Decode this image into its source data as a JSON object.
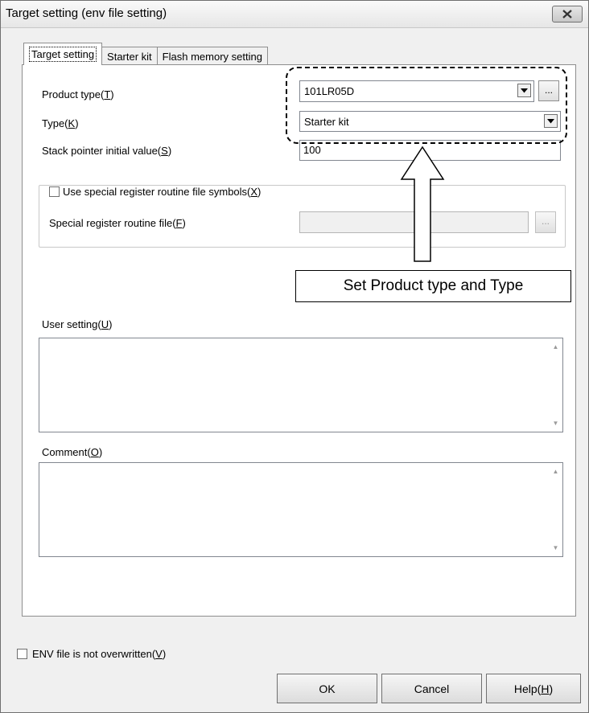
{
  "window": {
    "title": "Target setting (env file setting)"
  },
  "tabs": [
    {
      "label": "Target setting"
    },
    {
      "label": "Starter kit"
    },
    {
      "label": "Flash memory setting"
    }
  ],
  "form": {
    "product_type": {
      "label": "Product type(",
      "key": "T",
      "suffix": ")",
      "value": "101LR05D",
      "browse": "..."
    },
    "type": {
      "label": "Type(",
      "key": "K",
      "suffix": ")",
      "value": "Starter kit"
    },
    "stack_pointer": {
      "label": "Stack pointer initial value(",
      "key": "S",
      "suffix": ")",
      "value": "100"
    },
    "use_special": {
      "label": "Use special register routine file symbols(",
      "key": "X",
      "suffix": ")"
    },
    "special_file": {
      "label": "Special register routine file(",
      "key": "F",
      "suffix": ")",
      "value": "",
      "browse": "..."
    },
    "user_setting": {
      "label": "User setting(",
      "key": "U",
      "suffix": ")",
      "value": ""
    },
    "comment": {
      "label": "Comment(",
      "key": "O",
      "suffix": ")",
      "value": ""
    }
  },
  "annotation": {
    "text": "Set Product type and Type"
  },
  "footer": {
    "env_checkbox": {
      "label": "ENV file is not overwritten(",
      "key": "V",
      "suffix": ")"
    },
    "ok": "OK",
    "cancel": "Cancel",
    "help": {
      "label": "Help(",
      "key": "H",
      "suffix": ")"
    }
  }
}
